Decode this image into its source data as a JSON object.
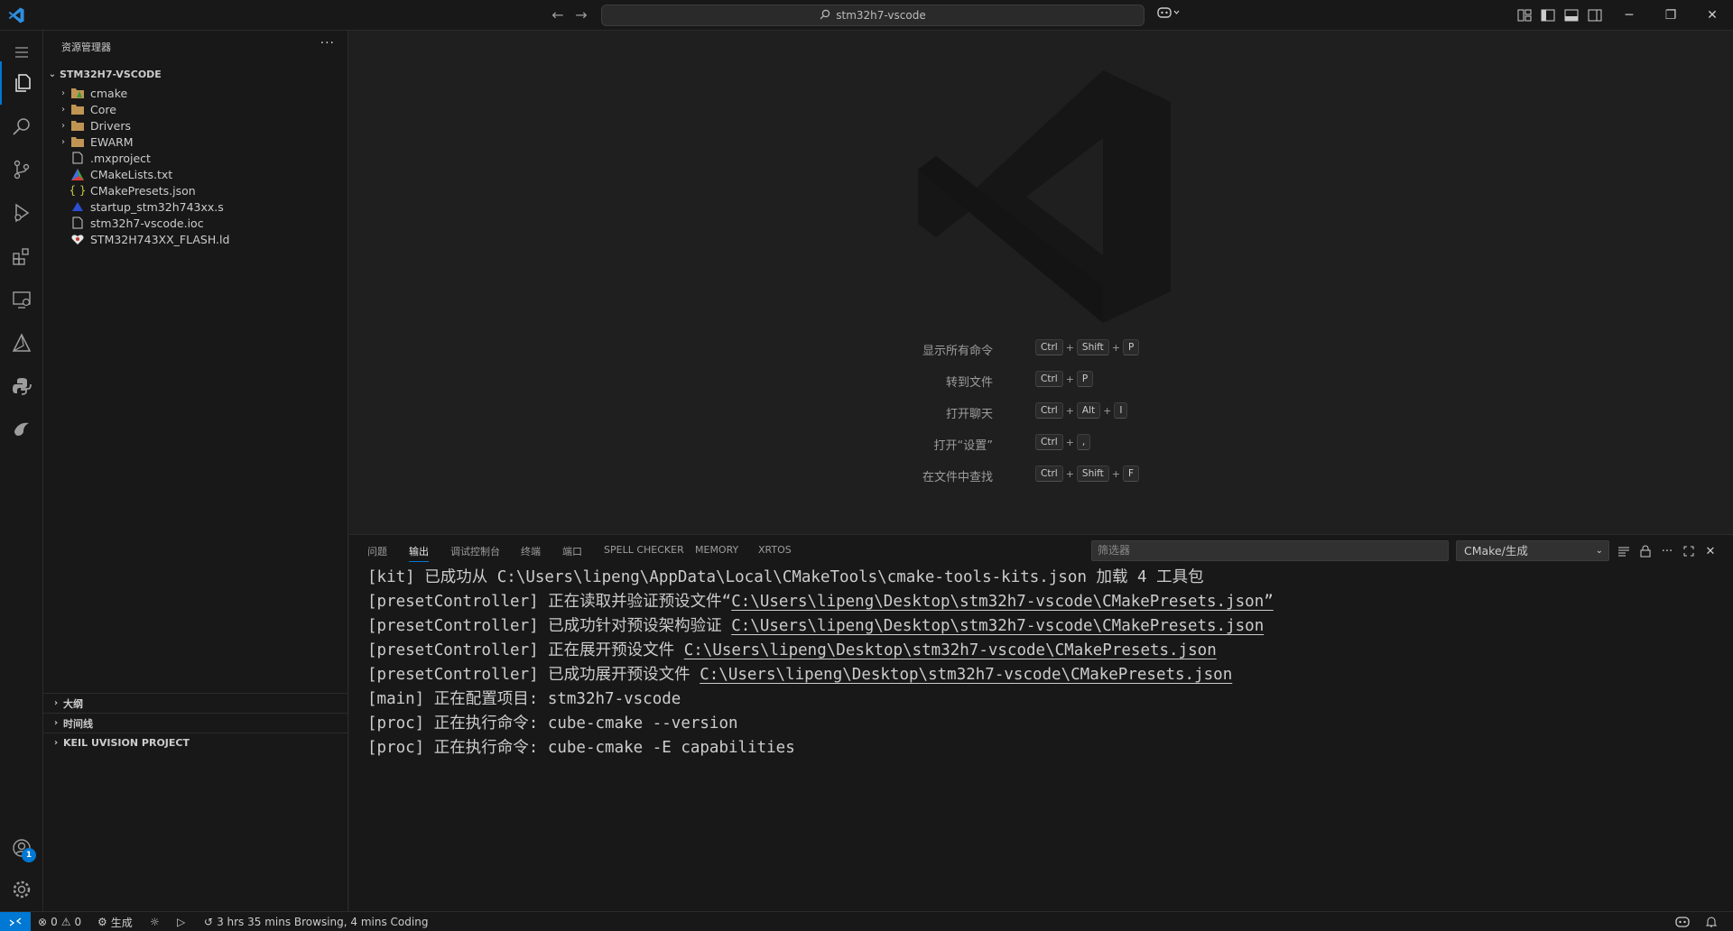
{
  "titlebar": {
    "search_text": "stm32h7-vscode",
    "back_icon": "arrow-left-icon",
    "forward_icon": "arrow-right-icon"
  },
  "colors": {
    "accent": "#0078d4",
    "background": "#1f1f1f",
    "sidebar": "#181818"
  },
  "explorer": {
    "header": "资源管理器",
    "more": "···",
    "root": "STM32H7-VSCODE",
    "items": [
      {
        "label": "cmake",
        "kind": "folder",
        "icon": "cmake-folder-icon"
      },
      {
        "label": "Core",
        "kind": "folder",
        "icon": "folder-icon"
      },
      {
        "label": "Drivers",
        "kind": "folder",
        "icon": "folder-icon"
      },
      {
        "label": "EWARM",
        "kind": "folder",
        "icon": "folder-icon"
      },
      {
        "label": ".mxproject",
        "kind": "file",
        "icon": "file-icon"
      },
      {
        "label": "CMakeLists.txt",
        "kind": "file",
        "icon": "cmake-icon"
      },
      {
        "label": "CMakePresets.json",
        "kind": "file",
        "icon": "json-icon"
      },
      {
        "label": "startup_stm32h743xx.s",
        "kind": "file",
        "icon": "assembly-icon"
      },
      {
        "label": "stm32h7-vscode.ioc",
        "kind": "file",
        "icon": "file-icon"
      },
      {
        "label": "STM32H743XX_FLASH.ld",
        "kind": "file",
        "icon": "linker-icon"
      }
    ],
    "sections": [
      {
        "label": "大纲"
      },
      {
        "label": "时间线"
      },
      {
        "label": "KEIL UVISION PROJECT"
      }
    ]
  },
  "activity": {
    "account_badge": "1"
  },
  "welcome": {
    "shortcuts": [
      {
        "label": "显示所有命令",
        "keys": [
          "Ctrl",
          "Shift",
          "P"
        ]
      },
      {
        "label": "转到文件",
        "keys": [
          "Ctrl",
          "P"
        ]
      },
      {
        "label": "打开聊天",
        "keys": [
          "Ctrl",
          "Alt",
          "I"
        ]
      },
      {
        "label": "打开“设置”",
        "keys": [
          "Ctrl",
          ","
        ]
      },
      {
        "label": "在文件中查找",
        "keys": [
          "Ctrl",
          "Shift",
          "F"
        ]
      }
    ],
    "plus": "+"
  },
  "panel": {
    "tabs": [
      {
        "label": "问题",
        "active": false
      },
      {
        "label": "输出",
        "active": true
      },
      {
        "label": "调试控制台",
        "active": false
      },
      {
        "label": "终端",
        "active": false
      },
      {
        "label": "端口",
        "active": false
      },
      {
        "label": "SPELL CHECKER",
        "active": false
      },
      {
        "label": "MEMORY",
        "active": false
      },
      {
        "label": "XRTOS",
        "active": false
      }
    ],
    "filter_placeholder": "筛选器",
    "channel": "CMake/生成",
    "output_lines": [
      {
        "text": "[kit] 已成功从 C:\\Users\\lipeng\\AppData\\Local\\CMakeTools\\cmake-tools-kits.json 加载 4 工具包",
        "link": "",
        "suffix": ""
      },
      {
        "text": "[presetController] 正在读取并验证预设文件“",
        "link": "C:\\Users\\lipeng\\Desktop\\stm32h7-vscode\\CMakePresets.json”",
        "suffix": ""
      },
      {
        "text": "[presetController] 已成功针对预设架构验证 ",
        "link": "C:\\Users\\lipeng\\Desktop\\stm32h7-vscode\\CMakePresets.json",
        "suffix": ""
      },
      {
        "text": "[presetController] 正在展开预设文件 ",
        "link": "C:\\Users\\lipeng\\Desktop\\stm32h7-vscode\\CMakePresets.json",
        "suffix": ""
      },
      {
        "text": "[presetController] 已成功展开预设文件 ",
        "link": "C:\\Users\\lipeng\\Desktop\\stm32h7-vscode\\CMakePresets.json",
        "suffix": ""
      },
      {
        "text": "[main] 正在配置项目: stm32h7-vscode",
        "link": "",
        "suffix": ""
      },
      {
        "text": "[proc] 正在执行命令: cube-cmake --version",
        "link": "",
        "suffix": ""
      },
      {
        "text": "[proc] 正在执行命令: cube-cmake -E capabilities",
        "link": "",
        "suffix": ""
      }
    ]
  },
  "statusbar": {
    "errors": "0",
    "warnings": "0",
    "build": "生成",
    "time_tracking": "3 hrs 35 mins Browsing, 4 mins Coding"
  }
}
